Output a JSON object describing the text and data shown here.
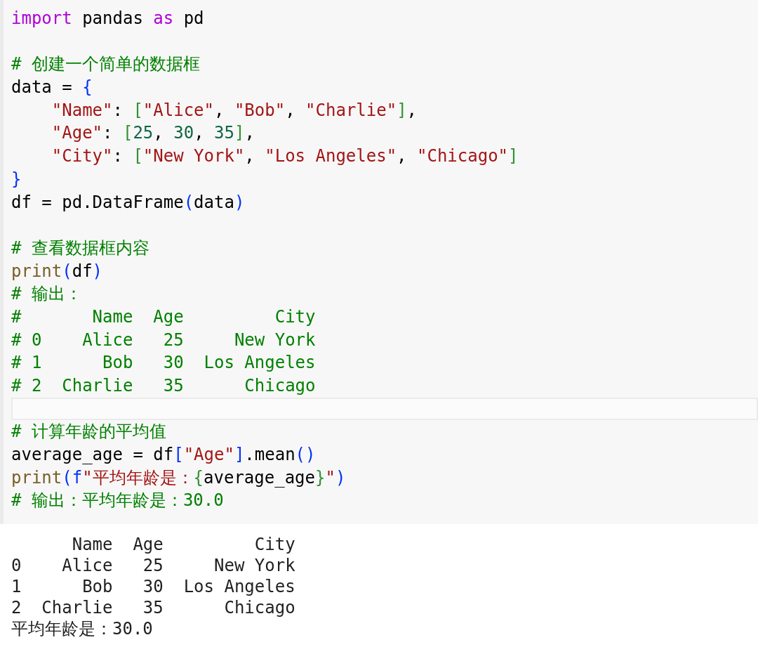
{
  "code_cell": {
    "lines": [
      {
        "kind": "code",
        "tokens": [
          {
            "kind": "keyword",
            "text": "import"
          },
          {
            "kind": "plain",
            "text": " pandas "
          },
          {
            "kind": "keyword",
            "text": "as"
          },
          {
            "kind": "plain",
            "text": " pd"
          }
        ]
      },
      {
        "kind": "blank"
      },
      {
        "kind": "code",
        "tokens": [
          {
            "kind": "comment",
            "text": "# 创建一个简单的数据框"
          }
        ]
      },
      {
        "kind": "code",
        "tokens": [
          {
            "kind": "plain",
            "text": "data = "
          },
          {
            "kind": "paren",
            "text": "{"
          }
        ]
      },
      {
        "kind": "code",
        "tokens": [
          {
            "kind": "string",
            "text": "    \"Name\""
          },
          {
            "kind": "plain",
            "text": ": "
          },
          {
            "kind": "bracket",
            "text": "["
          },
          {
            "kind": "string",
            "text": "\"Alice\""
          },
          {
            "kind": "plain",
            "text": ", "
          },
          {
            "kind": "string",
            "text": "\"Bob\""
          },
          {
            "kind": "plain",
            "text": ", "
          },
          {
            "kind": "string",
            "text": "\"Charlie\""
          },
          {
            "kind": "bracket",
            "text": "]"
          },
          {
            "kind": "plain",
            "text": ","
          }
        ]
      },
      {
        "kind": "code",
        "tokens": [
          {
            "kind": "string",
            "text": "    \"Age\""
          },
          {
            "kind": "plain",
            "text": ": "
          },
          {
            "kind": "bracket",
            "text": "["
          },
          {
            "kind": "number",
            "text": "25"
          },
          {
            "kind": "plain",
            "text": ", "
          },
          {
            "kind": "number",
            "text": "30"
          },
          {
            "kind": "plain",
            "text": ", "
          },
          {
            "kind": "number",
            "text": "35"
          },
          {
            "kind": "bracket",
            "text": "]"
          },
          {
            "kind": "plain",
            "text": ","
          }
        ]
      },
      {
        "kind": "code",
        "tokens": [
          {
            "kind": "string",
            "text": "    \"City\""
          },
          {
            "kind": "plain",
            "text": ": "
          },
          {
            "kind": "bracket",
            "text": "["
          },
          {
            "kind": "string",
            "text": "\"New York\""
          },
          {
            "kind": "plain",
            "text": ", "
          },
          {
            "kind": "string",
            "text": "\"Los Angeles\""
          },
          {
            "kind": "plain",
            "text": ", "
          },
          {
            "kind": "string",
            "text": "\"Chicago\""
          },
          {
            "kind": "bracket",
            "text": "]"
          }
        ]
      },
      {
        "kind": "code",
        "tokens": [
          {
            "kind": "paren",
            "text": "}"
          }
        ]
      },
      {
        "kind": "code",
        "tokens": [
          {
            "kind": "plain",
            "text": "df = pd.DataFrame"
          },
          {
            "kind": "paren",
            "text": "("
          },
          {
            "kind": "plain",
            "text": "data"
          },
          {
            "kind": "paren",
            "text": ")"
          }
        ]
      },
      {
        "kind": "blank"
      },
      {
        "kind": "code",
        "tokens": [
          {
            "kind": "comment",
            "text": "# 查看数据框内容"
          }
        ]
      },
      {
        "kind": "code",
        "tokens": [
          {
            "kind": "builtin",
            "text": "print"
          },
          {
            "kind": "paren",
            "text": "("
          },
          {
            "kind": "plain",
            "text": "df"
          },
          {
            "kind": "paren",
            "text": ")"
          }
        ]
      },
      {
        "kind": "code",
        "tokens": [
          {
            "kind": "comment",
            "text": "# 输出："
          }
        ]
      },
      {
        "kind": "code",
        "tokens": [
          {
            "kind": "comment",
            "text": "#       Name  Age         City"
          }
        ]
      },
      {
        "kind": "code",
        "tokens": [
          {
            "kind": "comment",
            "text": "# 0    Alice   25     New York"
          }
        ]
      },
      {
        "kind": "code",
        "tokens": [
          {
            "kind": "comment",
            "text": "# 1      Bob   30  Los Angeles"
          }
        ]
      },
      {
        "kind": "code",
        "tokens": [
          {
            "kind": "comment",
            "text": "# 2  Charlie   35      Chicago"
          }
        ]
      },
      {
        "kind": "highlight"
      },
      {
        "kind": "code",
        "tokens": [
          {
            "kind": "comment",
            "text": "# 计算年龄的平均值"
          }
        ]
      },
      {
        "kind": "code",
        "tokens": [
          {
            "kind": "plain",
            "text": "average_age = df"
          },
          {
            "kind": "paren",
            "text": "["
          },
          {
            "kind": "string",
            "text": "\"Age\""
          },
          {
            "kind": "paren",
            "text": "]"
          },
          {
            "kind": "plain",
            "text": ".mean"
          },
          {
            "kind": "paren",
            "text": "()"
          }
        ]
      },
      {
        "kind": "code",
        "tokens": [
          {
            "kind": "builtin",
            "text": "print"
          },
          {
            "kind": "paren",
            "text": "("
          },
          {
            "kind": "paren",
            "text": "f"
          },
          {
            "kind": "string",
            "text": "\"平均年龄是："
          },
          {
            "kind": "bracket",
            "text": "{"
          },
          {
            "kind": "plain",
            "text": "average_age"
          },
          {
            "kind": "bracket",
            "text": "}"
          },
          {
            "kind": "string",
            "text": "\""
          },
          {
            "kind": "paren",
            "text": ")"
          }
        ]
      },
      {
        "kind": "code",
        "tokens": [
          {
            "kind": "comment",
            "text": "# 输出：平均年龄是：30.0"
          }
        ]
      }
    ]
  },
  "output": {
    "lines": [
      "      Name  Age         City",
      "0    Alice   25     New York",
      "1      Bob   30  Los Angeles",
      "2  Charlie   35      Chicago",
      "平均年龄是：30.0"
    ]
  }
}
